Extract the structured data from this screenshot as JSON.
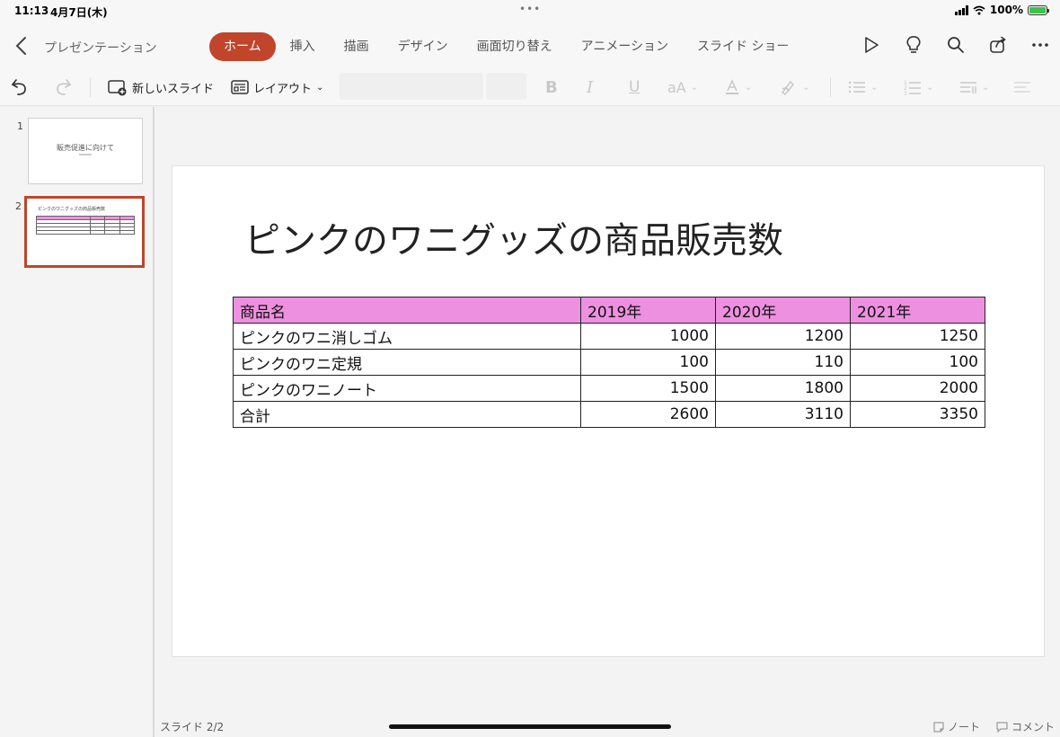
{
  "status": {
    "time": "11:13",
    "date": "4月7日(木)",
    "dots": "•••",
    "battery": "100%"
  },
  "header": {
    "doc_title": "プレゼンテーション",
    "tabs": [
      {
        "label": "ホーム",
        "active": true
      },
      {
        "label": "挿入"
      },
      {
        "label": "描画"
      },
      {
        "label": "デザイン"
      },
      {
        "label": "画面切り替え"
      },
      {
        "label": "アニメーション"
      },
      {
        "label": "スライド ショー"
      }
    ],
    "right_icons": [
      "play-icon",
      "lightbulb-icon",
      "search-icon",
      "share-icon",
      "more-icon"
    ]
  },
  "toolbar": {
    "new_slide": "新しいスライド",
    "layout": "レイアウト",
    "format_icons": [
      "bold-icon",
      "italic-icon",
      "underline-icon",
      "font-size-icon",
      "font-color-icon",
      "highlight-icon",
      "bullets-icon",
      "numbering-icon",
      "paragraph-icon",
      "align-icon"
    ]
  },
  "thumbnails": [
    {
      "number": "1",
      "title": "販売促進に向けて"
    },
    {
      "number": "2",
      "title": "ピンクのワニグッズの商品販売数",
      "selected": true
    }
  ],
  "slide": {
    "title": "ピンクのワニグッズの商品販売数",
    "table": {
      "headers": [
        "商品名",
        "2019年",
        "2020年",
        "2021年"
      ],
      "rows": [
        [
          "ピンクのワニ消しゴム",
          "1000",
          "1200",
          "1250"
        ],
        [
          "ピンクのワニ定規",
          "100",
          "110",
          "100"
        ],
        [
          "ピンクのワニノート",
          "1500",
          "1800",
          "2000"
        ],
        [
          "合計",
          "2600",
          "3110",
          "3350"
        ]
      ],
      "header_color": "#ee90e0"
    }
  },
  "footer": {
    "slide_counter": "スライド 2/2",
    "notes": "ノート",
    "comments": "コメント"
  },
  "colors": {
    "accent": "#c0452b"
  }
}
